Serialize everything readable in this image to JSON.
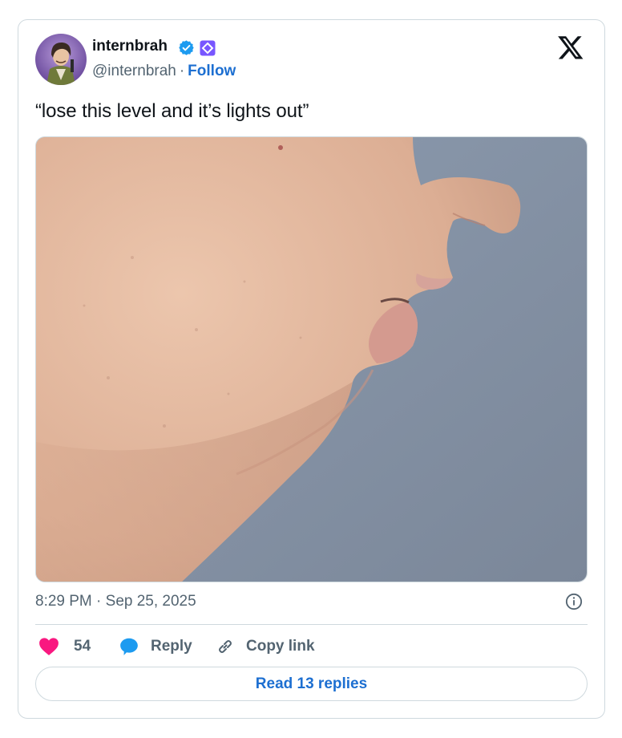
{
  "author": {
    "display_name": "internbrah",
    "handle": "@internbrah",
    "separator": "·",
    "follow_label": "Follow",
    "verified_color": "#1d9bf0",
    "affiliation_color": "#7856ff"
  },
  "tweet": {
    "text": "“lose this level and it’s lights out”",
    "timestamp": "8:29 PM · Sep 25, 2025"
  },
  "engagement": {
    "likes": "54",
    "reply_label": "Reply",
    "copy_link_label": "Copy link",
    "read_replies_label": "Read 13 replies",
    "like_color": "#f91880",
    "reply_color": "#1d9bf0"
  },
  "icons": {
    "brand": "x-logo-icon",
    "verified": "verified-badge-icon",
    "affiliation": "affiliation-badge-icon",
    "info": "info-icon",
    "like": "heart-icon",
    "reply": "speech-bubble-icon",
    "copy": "link-icon"
  }
}
